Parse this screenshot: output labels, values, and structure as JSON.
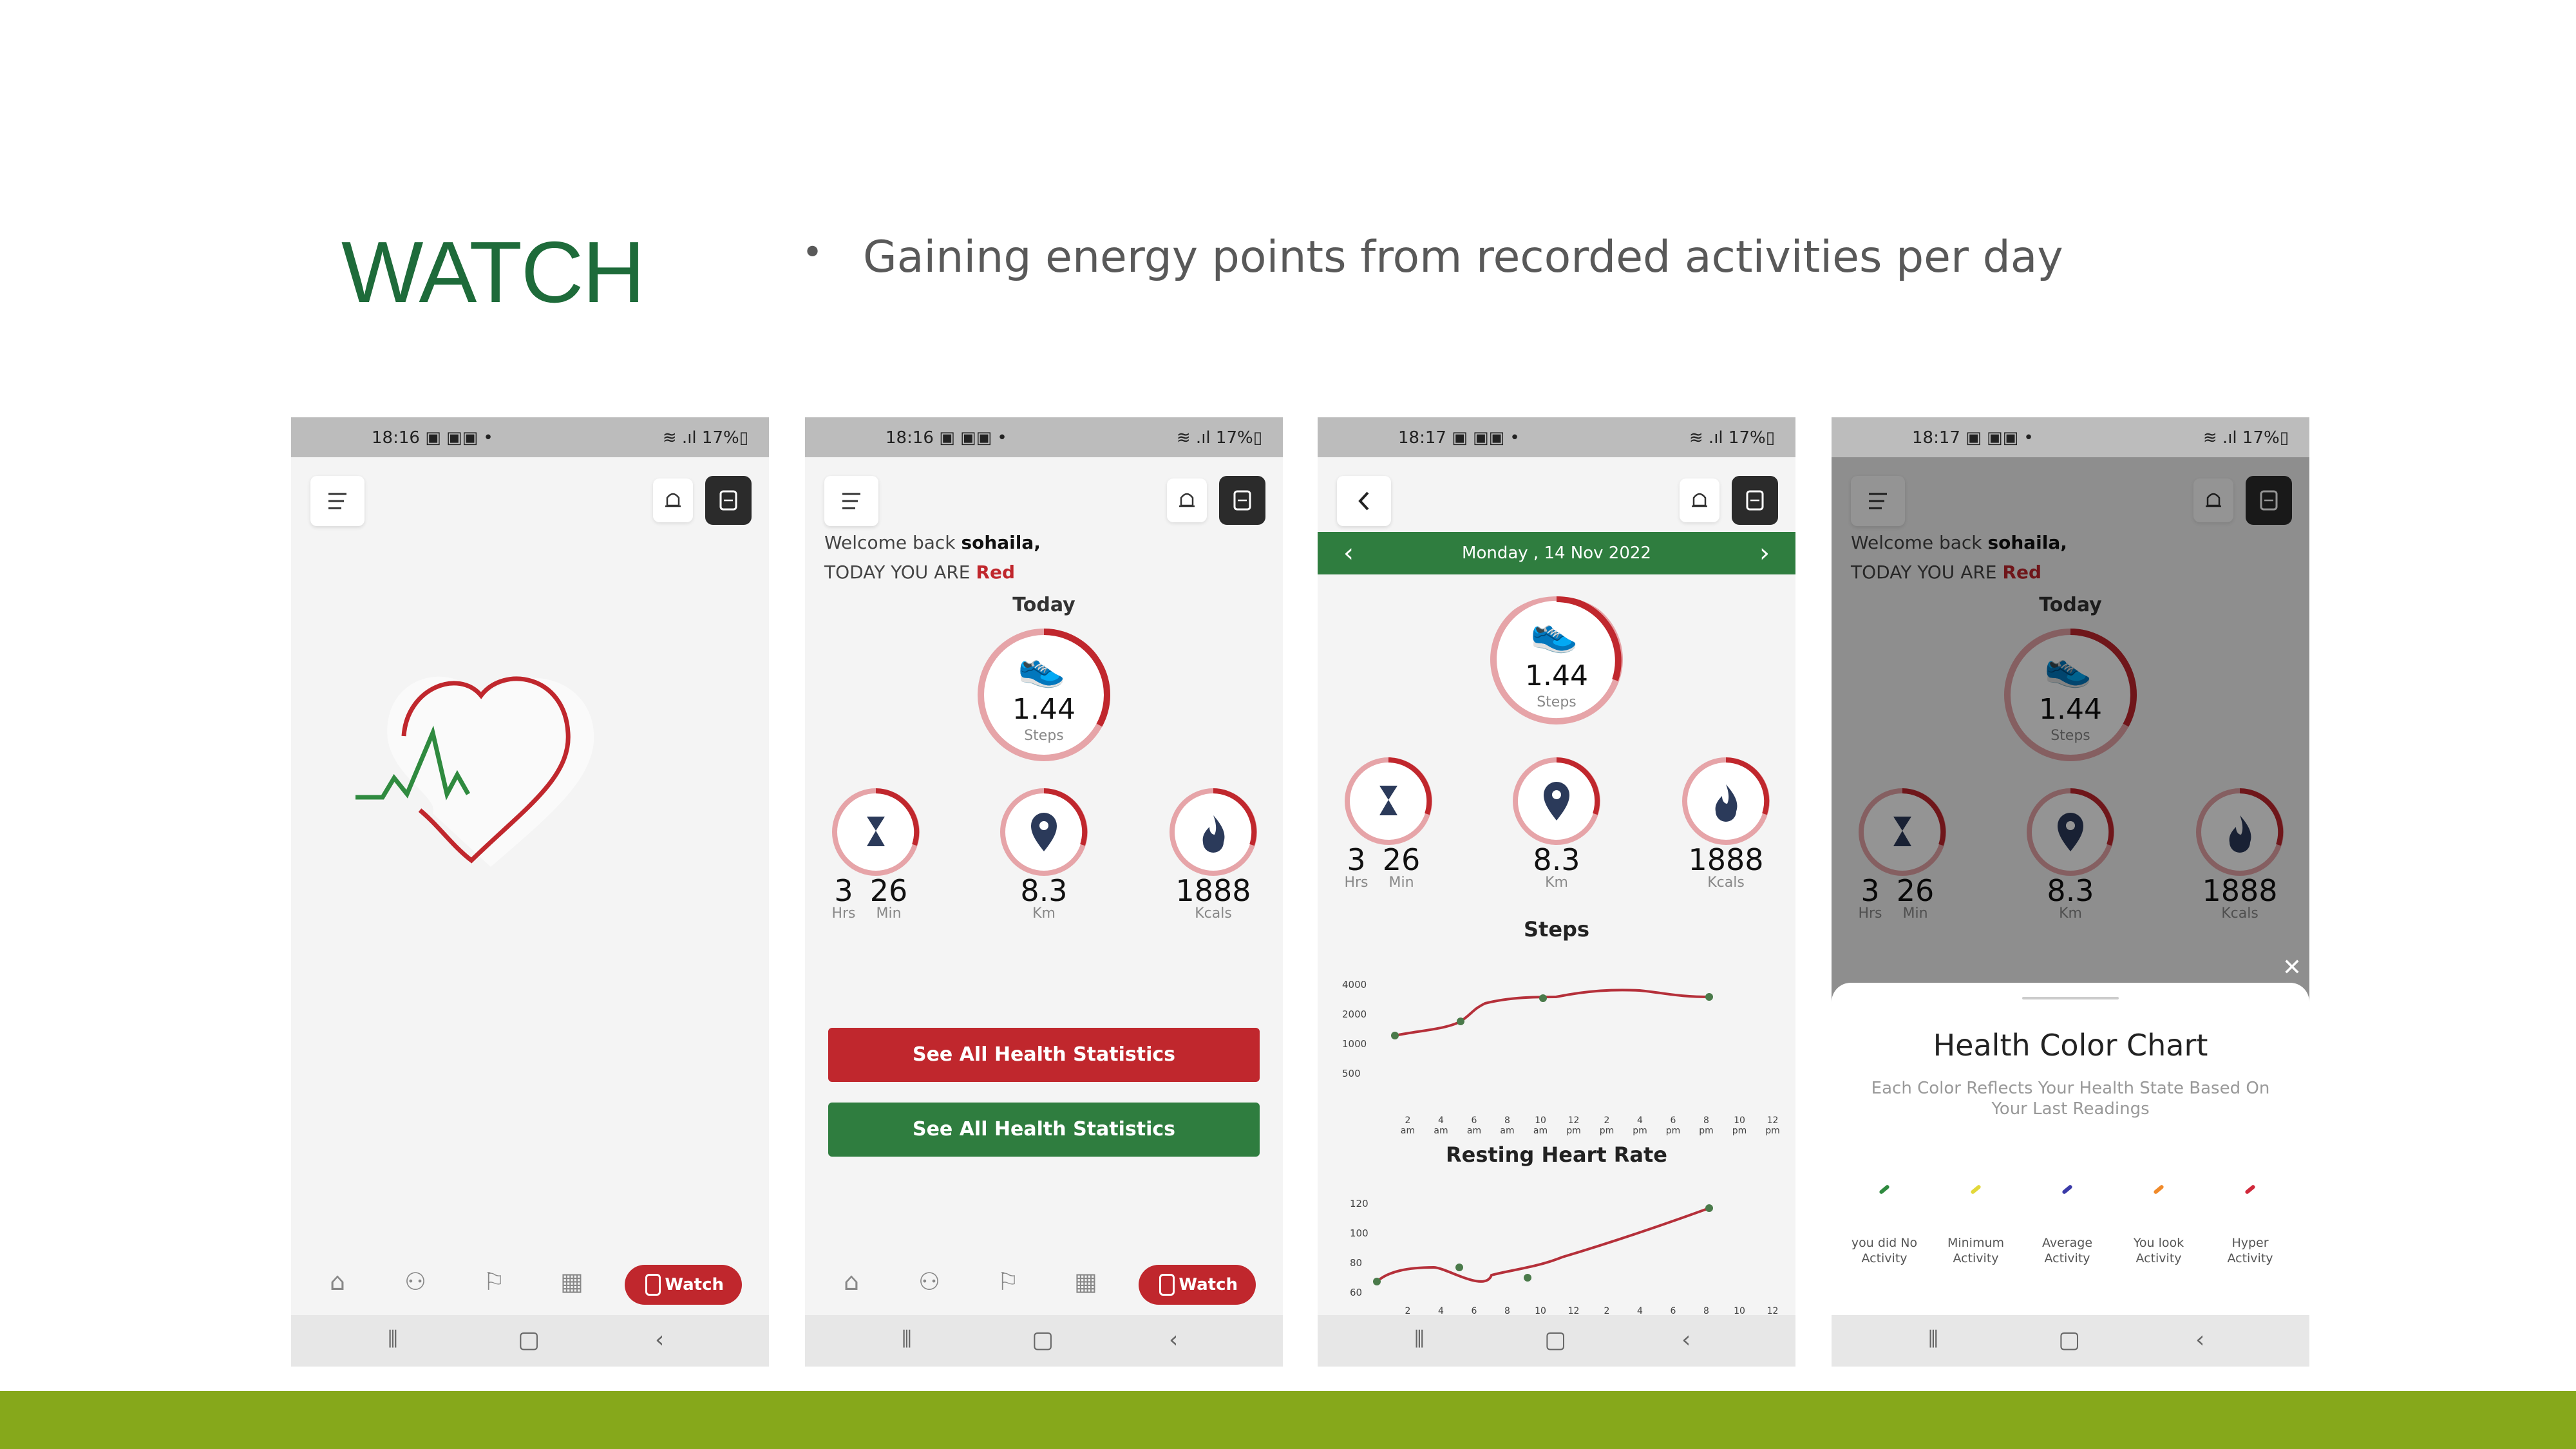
{
  "slide": {
    "title": "WATCH",
    "bullet": "Gaining energy points from recorded activities per day"
  },
  "status_bar": {
    "time_1": "18:16 ▣ ▣▣ •",
    "time_2": "18:16 ▣ ▣▣ •",
    "time_3": "18:17 ▣ ▣▣ •",
    "time_4": "18:17 ▣ ▣▣ •",
    "right": "≋ .ıl 17%▯"
  },
  "nav": {
    "watch_label": "Watch"
  },
  "dashboard": {
    "welcome_prefix": "Welcome back",
    "user": "sohaila,",
    "today_prefix": "TODAY YOU ARE",
    "state": "Red",
    "today_label": "Today",
    "steps_value": "1.44",
    "steps_label": "Steps",
    "hrs": "3",
    "mins": "26",
    "hrs_label": "Hrs",
    "min_label": "Min",
    "km_value": "8.3",
    "km_label": "Km",
    "kcal_value": "1888",
    "kcal_label": "Kcals",
    "btn_red": "See All Health Statistics",
    "btn_green": "See All Health Statistics"
  },
  "detail": {
    "date": "Monday , 14 Nov 2022",
    "steps_title": "Steps",
    "hr_title": "Resting Heart Rate",
    "steps_y": [
      "4000",
      "2000",
      "1000",
      "500"
    ],
    "steps_x": [
      "2\nam",
      "4\nam",
      "6\nam",
      "8\nam",
      "10\nam",
      "12\npm",
      "2\npm",
      "4\npm",
      "6\npm",
      "8\npm",
      "10\npm",
      "12\npm"
    ],
    "hr_y": [
      "120",
      "100",
      "80",
      "60"
    ],
    "hr_x": [
      "2",
      "4",
      "6",
      "8",
      "10",
      "12",
      "2",
      "4",
      "6",
      "8",
      "10",
      "12"
    ]
  },
  "sheet": {
    "title": "Health Color Chart",
    "desc": "Each Color Reflects Your Health State Based On Your Last Readings",
    "legend": [
      {
        "label": "you did No Activity",
        "color": "#2f8a3f"
      },
      {
        "label": "Minimum Activity",
        "color": "#e3d83a"
      },
      {
        "label": "Average Activity",
        "color": "#3a3aa8"
      },
      {
        "label": "You look Activity",
        "color": "#f08a2a"
      },
      {
        "label": "Hyper Activity",
        "color": "#d0283a"
      }
    ],
    "close": "✕"
  },
  "colors": {
    "brand_green": "#1e6b3a",
    "alert_red": "#c0272d",
    "accent_bar": "#86a81b"
  }
}
